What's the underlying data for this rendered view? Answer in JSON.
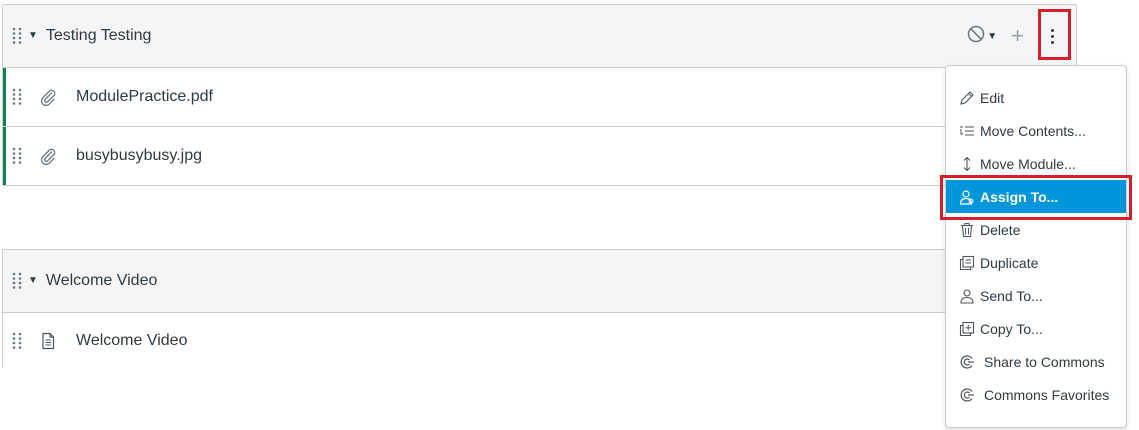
{
  "modules": [
    {
      "title": "Testing Testing",
      "items": [
        {
          "title": "ModulePractice.pdf",
          "icon": "paperclip-icon"
        },
        {
          "title": "busybusybusy.jpg",
          "icon": "paperclip-icon"
        }
      ]
    },
    {
      "title": "Welcome Video",
      "items": [
        {
          "title": "Welcome Video",
          "icon": "page-icon"
        }
      ]
    }
  ],
  "module_actions": {
    "publish_icon": "unpublished-circle-icon",
    "add_icon": "plus-icon",
    "more_icon": "kebab-icon"
  },
  "menu": {
    "items": [
      {
        "label": "Edit",
        "icon": "pencil-icon"
      },
      {
        "label": "Move Contents...",
        "icon": "move-contents-icon"
      },
      {
        "label": "Move Module...",
        "icon": "updown-arrow-icon"
      },
      {
        "label": "Assign To...",
        "icon": "assign-user-icon",
        "active": true
      },
      {
        "label": "Delete",
        "icon": "trash-icon"
      },
      {
        "label": "Duplicate",
        "icon": "duplicate-icon"
      },
      {
        "label": "Send To...",
        "icon": "user-icon"
      },
      {
        "label": "Copy To...",
        "icon": "copy-icon"
      },
      {
        "label": "Share to Commons",
        "icon": "commons-icon"
      },
      {
        "label": "Commons Favorites",
        "icon": "commons-icon"
      }
    ]
  },
  "colors": {
    "published_bar": "#0b874b",
    "menu_active_bg": "#0096db",
    "highlight_box": "#d71e2b",
    "item_icon_green": "#0b874b"
  }
}
